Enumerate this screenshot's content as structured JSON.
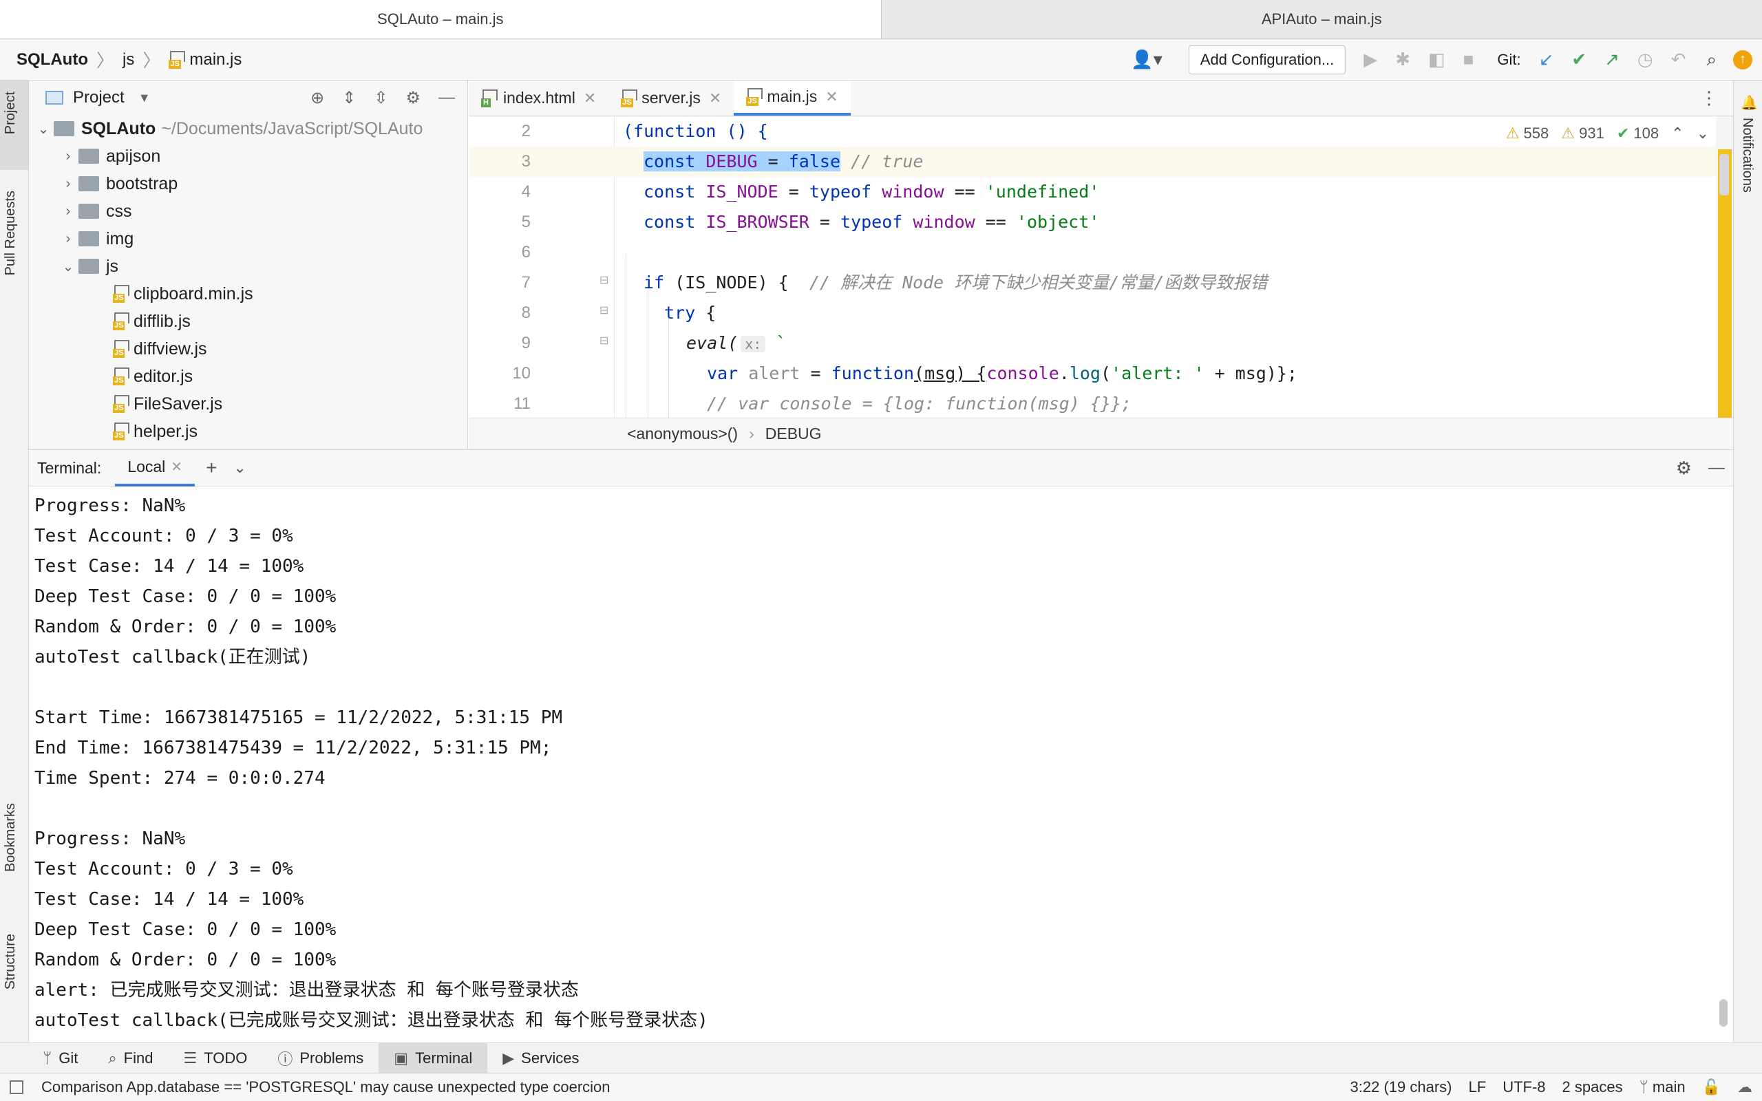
{
  "window_tabs": [
    "SQLAuto – main.js",
    "APIAuto – main.js"
  ],
  "breadcrumb": [
    "SQLAuto",
    "js",
    "main.js"
  ],
  "toolbar": {
    "add_config": "Add Configuration...",
    "git_label": "Git:"
  },
  "left_stripe": {
    "project": "Project",
    "pull_requests": "Pull Requests",
    "bookmarks": "Bookmarks",
    "structure": "Structure"
  },
  "right_stripe": {
    "notifications": "Notifications"
  },
  "project_panel": {
    "title": "Project",
    "root": {
      "name": "SQLAuto",
      "path": "~/Documents/JavaScript/SQLAuto"
    },
    "folders": [
      "apijson",
      "bootstrap",
      "css",
      "img",
      "js"
    ],
    "files": [
      "clipboard.min.js",
      "difflib.js",
      "diffview.js",
      "editor.js",
      "FileSaver.js",
      "helper.js"
    ]
  },
  "editor": {
    "tabs": [
      "index.html",
      "server.js",
      "main.js"
    ],
    "inspections": {
      "warnings": "558",
      "weak_warnings": "931",
      "typos": "108"
    },
    "breadcrumb": [
      "<anonymous>()",
      "DEBUG"
    ],
    "inlay_hint": "x:"
  },
  "code_lines": [
    {
      "n": "2"
    },
    {
      "n": "3"
    },
    {
      "n": "4"
    },
    {
      "n": "5"
    },
    {
      "n": "6"
    },
    {
      "n": "7"
    },
    {
      "n": "8"
    },
    {
      "n": "9"
    },
    {
      "n": "10"
    },
    {
      "n": "11"
    }
  ],
  "code": {
    "l2": "(function () {",
    "l3_const": "const",
    "l3_name": "DEBUG",
    "l3_eq": " = ",
    "l3_val": "false",
    "l3_cmt": " // true",
    "l4_const": "const",
    "l4_name": " IS_NODE",
    "l4_rest": " = ",
    "l4_typeof": "typeof",
    "l4_window": " window",
    "l4_eq": " == ",
    "l4_str": "'undefined'",
    "l5_const": "const",
    "l5_name": " IS_BROWSER",
    "l5_rest": " = ",
    "l5_typeof": "typeof",
    "l5_window": " window",
    "l5_eq": " == ",
    "l5_str": "'object'",
    "l7_if": "if",
    "l7_cond": " (IS_NODE) {  ",
    "l7_cmt": "// 解决在 Node 环境下缺少相关变量/常量/函数导致报错",
    "l8_try": "try",
    "l8_rest": " {",
    "l9_eval": "eval(",
    "l9_tick": " `",
    "l10_var": "var",
    "l10_alert": " alert",
    "l10_eq": " = ",
    "l10_function": "function",
    "l10_args": "(msg) {",
    "l10_console": "console",
    "l10_dot": ".",
    "l10_log": "log",
    "l10_open": "(",
    "l10_str": "'alert: '",
    "l10_plus": " + msg)};",
    "l11_cmt": "// var console = {log: function(msg) {}};"
  },
  "terminal": {
    "label": "Terminal:",
    "tab": "Local",
    "lines": [
      "Progress: NaN%",
      "Test Account: 0 / 3 = 0%",
      "Test Case: 14 / 14 = 100%",
      "Deep Test Case: 0 / 0 = 100%",
      "Random & Order: 0 / 0 = 100%",
      "autoTest callback(正在测试)",
      "",
      "Start Time: 1667381475165 = 11/2/2022, 5:31:15 PM",
      "End Time: 1667381475439 = 11/2/2022, 5:31:15 PM;",
      "Time Spent: 274 = 0:0:0.274",
      "",
      "Progress: NaN%",
      "Test Account: 0 / 3 = 0%",
      "Test Case: 14 / 14 = 100%",
      "Deep Test Case: 0 / 0 = 100%",
      "Random & Order: 0 / 0 = 100%",
      "alert: 已完成账号交叉测试：退出登录状态 和 每个账号登录状态",
      "autoTest callback(已完成账号交叉测试：退出登录状态 和 每个账号登录状态)"
    ]
  },
  "tool_windows": [
    "Git",
    "Find",
    "TODO",
    "Problems",
    "Terminal",
    "Services"
  ],
  "status": {
    "message": "Comparison App.database == 'POSTGRESQL' may cause unexpected type coercion",
    "position": "3:22 (19 chars)",
    "line_sep": "LF",
    "encoding": "UTF-8",
    "indent": "2 spaces",
    "branch": "main"
  },
  "colors": {
    "accent": "#3d7ddb",
    "current_line": "#fcfaed",
    "selection": "#a6d2ff",
    "warning": "#f2c01b",
    "git_update": "#3c8fd6",
    "git_commit": "#4aa85a",
    "git_push": "#3aa05a"
  }
}
